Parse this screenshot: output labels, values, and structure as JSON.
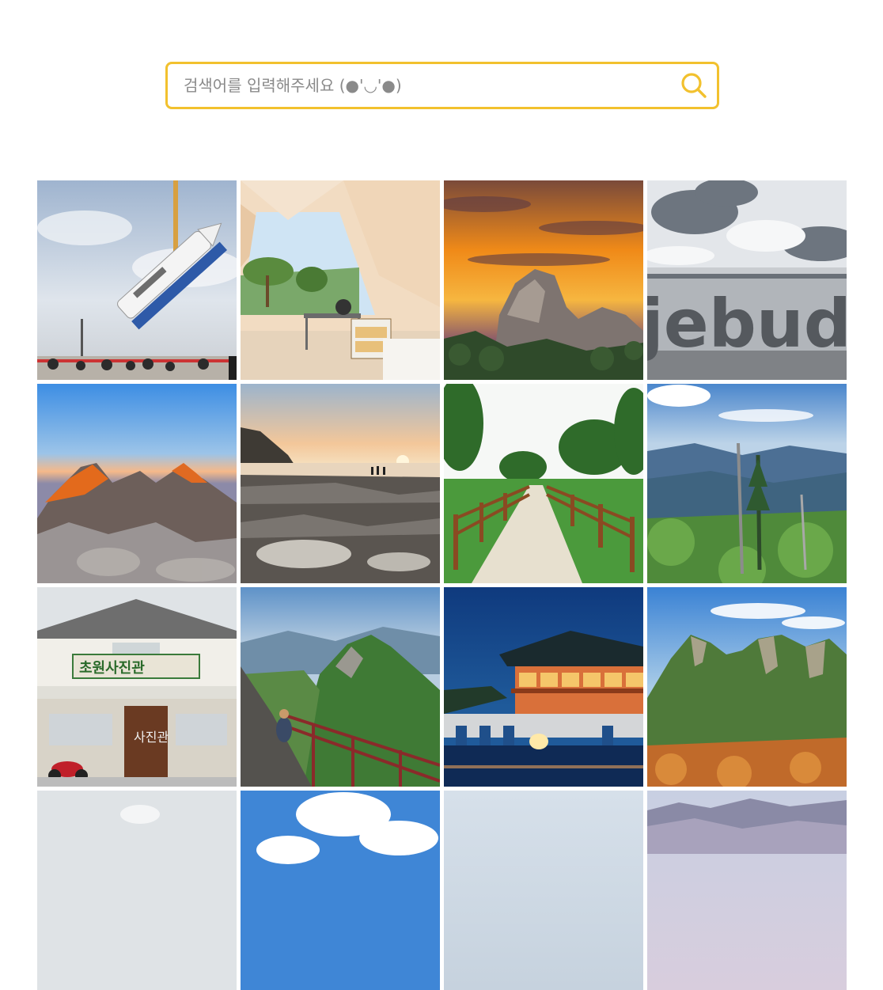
{
  "search": {
    "placeholder": "검색어를 입력해주세요 (●'◡'●)",
    "value": "",
    "icon": "search-icon",
    "accent_color": "#f2c12e"
  },
  "gallery": {
    "items": [
      {
        "name": "rocket-launch-photo",
        "alt": "rocket on launch pad"
      },
      {
        "name": "glamping-tent-photo",
        "alt": "glamping tent interior"
      },
      {
        "name": "sunrise-peak-photo",
        "alt": "rocky peak at sunrise"
      },
      {
        "name": "jebudo-sign-photo",
        "alt": "coastal sign by the sea",
        "sign_text": "jebudo"
      },
      {
        "name": "mountain-dawn-photo",
        "alt": "mountain ridge at dawn"
      },
      {
        "name": "rocky-coast-sunset-photo",
        "alt": "rocky coast at sunset"
      },
      {
        "name": "wooden-fence-path-photo",
        "alt": "path with wooden fence"
      },
      {
        "name": "mountain-trees-photo",
        "alt": "mountain view with dead trees"
      },
      {
        "name": "photo-studio-photo",
        "alt": "old photo studio storefront",
        "sign_text": "초원사진관",
        "door_text": "사진관"
      },
      {
        "name": "mountain-stairs-photo",
        "alt": "hikers on mountain stairs"
      },
      {
        "name": "night-pavilion-photo",
        "alt": "lit pavilion at night"
      },
      {
        "name": "green-mountain-photo",
        "alt": "green rocky mountain"
      },
      {
        "name": "hazy-sky-photo",
        "alt": "hazy sky"
      },
      {
        "name": "blue-sky-clouds-photo",
        "alt": "blue sky with clouds"
      },
      {
        "name": "pale-sky-photo",
        "alt": "pale sky"
      },
      {
        "name": "misty-mountains-photo",
        "alt": "misty mountains"
      }
    ]
  }
}
